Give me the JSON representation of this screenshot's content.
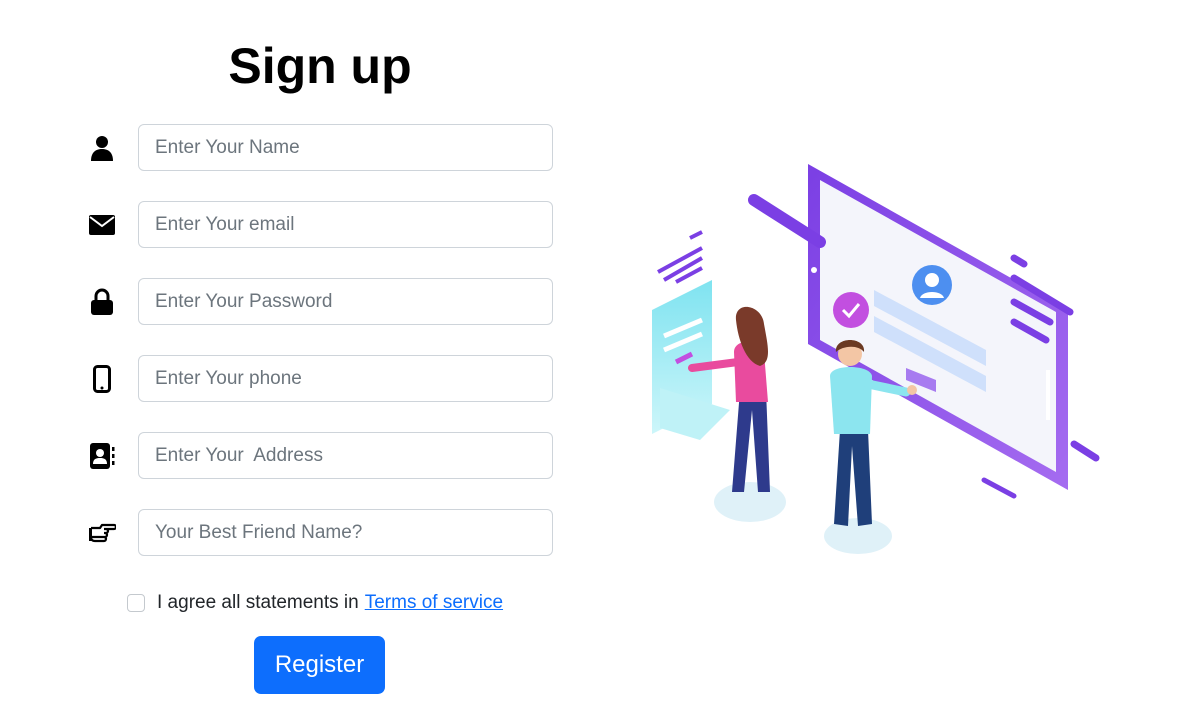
{
  "title": "Sign up",
  "fields": [
    {
      "icon": "person-icon",
      "placeholder": "Enter Your Name"
    },
    {
      "icon": "envelope-icon",
      "placeholder": "Enter Your email"
    },
    {
      "icon": "lock-icon",
      "placeholder": "Enter Your Password"
    },
    {
      "icon": "mobile-phone-icon",
      "placeholder": "Enter Your phone"
    },
    {
      "icon": "address-book-icon",
      "placeholder": "Enter Your  Address"
    },
    {
      "icon": "hand-pointing-icon",
      "placeholder": "Your Best Friend Name?"
    }
  ],
  "agree": {
    "text": "I agree all statements in",
    "link_text": "Terms of service",
    "checked": false
  },
  "register_label": "Register",
  "colors": {
    "primary": "#0d6efd",
    "illustration_purple": "#7b3fe4",
    "illustration_pink": "#e94b9e",
    "illustration_cyan": "#7fe3f0"
  }
}
